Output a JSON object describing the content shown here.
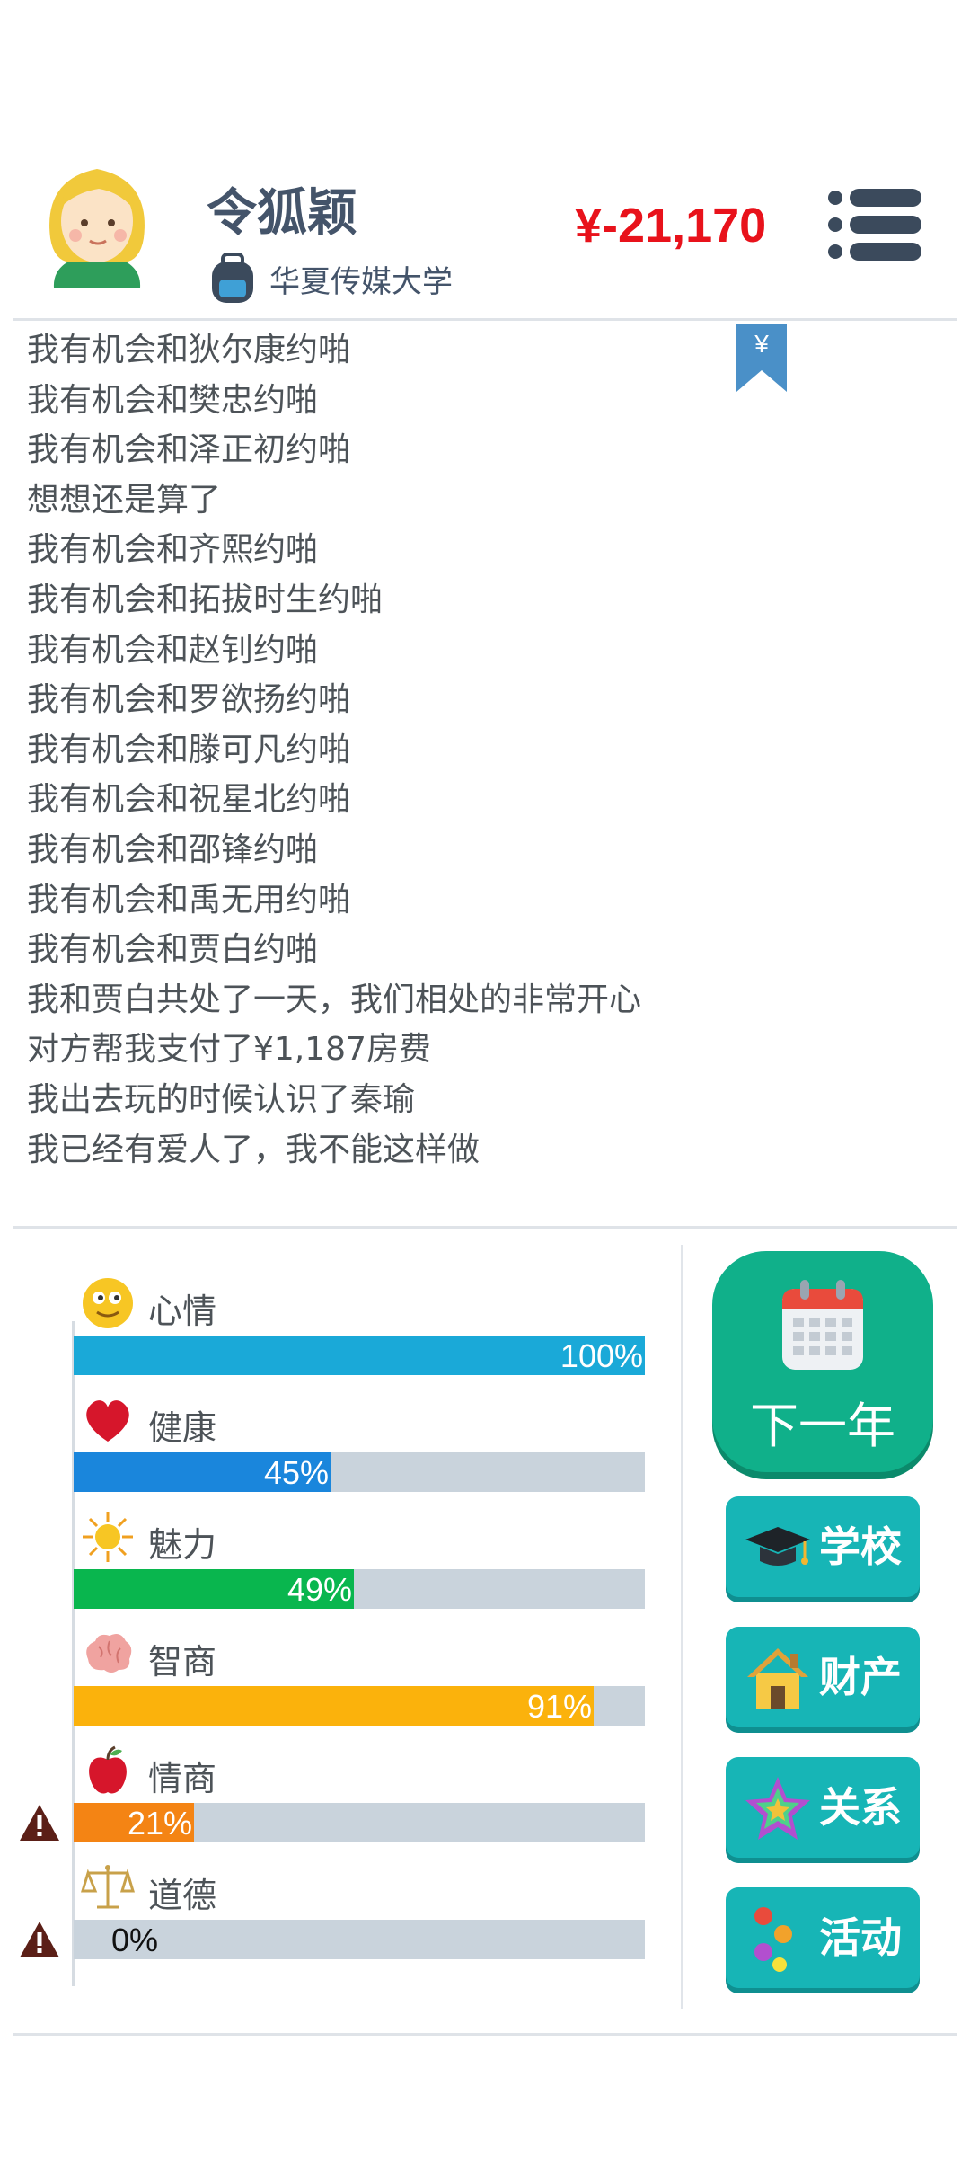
{
  "profile": {
    "name": "令狐颖",
    "school": "华夏传媒大学",
    "money": "¥-21,170"
  },
  "bookmark_symbol": "¥",
  "log": [
    "我有机会和狄尔康约啪",
    "我有机会和樊忠约啪",
    "我有机会和泽正初约啪",
    "想想还是算了",
    "我有机会和齐熙约啪",
    "我有机会和拓拔时生约啪",
    "我有机会和赵钊约啪",
    "我有机会和罗欲扬约啪",
    "我有机会和滕可凡约啪",
    "我有机会和祝星北约啪",
    "我有机会和邵锋约啪",
    "我有机会和禹无用约啪",
    "我有机会和贾白约啪",
    "我和贾白共处了一天，我们相处的非常开心",
    "对方帮我支付了¥1,187房费",
    "我出去玩的时候认识了秦瑜",
    "我已经有爱人了，我不能这样做"
  ],
  "stats": [
    {
      "label": "心情",
      "value": 100,
      "text": "100%",
      "color": "#1aa9d8",
      "icon": "smiley-icon",
      "warning": false
    },
    {
      "label": "健康",
      "value": 45,
      "text": "45%",
      "color": "#1a86dc",
      "icon": "heart-icon",
      "warning": false
    },
    {
      "label": "魅力",
      "value": 49,
      "text": "49%",
      "color": "#09b64e",
      "icon": "sun-icon",
      "warning": false
    },
    {
      "label": "智商",
      "value": 91,
      "text": "91%",
      "color": "#fbb20c",
      "icon": "brain-icon",
      "warning": false
    },
    {
      "label": "情商",
      "value": 21,
      "text": "21%",
      "color": "#f48414",
      "icon": "apple-icon",
      "warning": true
    },
    {
      "label": "道德",
      "value": 0,
      "text": "0%",
      "color": "#c9d3dc",
      "icon": "scales-icon",
      "warning": true
    }
  ],
  "buttons": {
    "next_year": "下一年",
    "school": "学校",
    "property": "财产",
    "relations": "关系",
    "activity": "活动"
  },
  "colors": {
    "money": "#e8121b",
    "button": "#17b5b6",
    "next_year": "#10b08a"
  }
}
